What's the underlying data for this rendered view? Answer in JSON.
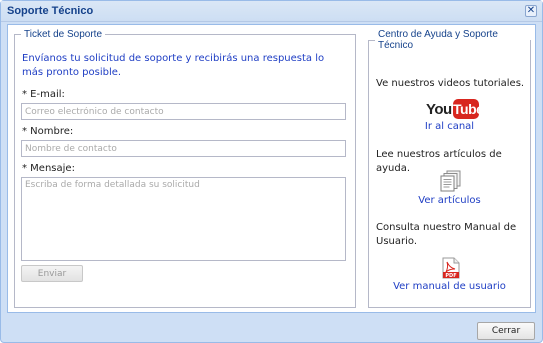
{
  "window": {
    "title": "Soporte Técnico",
    "close_glyph": "✕"
  },
  "ticket": {
    "legend": "Ticket de Soporte",
    "intro": "Envíanos tu solicitud de soporte y recibirás una respuesta lo más pronto posible.",
    "email_label": "* E-mail:",
    "email_placeholder": "Correo electrónico de contacto",
    "email_value": "",
    "name_label": "* Nombre:",
    "name_placeholder": "Nombre de contacto",
    "name_value": "",
    "message_label": "* Mensaje:",
    "message_placeholder": "Escriba de forma detallada su solicitud",
    "message_value": "",
    "send_label": "Enviar"
  },
  "help": {
    "legend": "Centro de Ayuda y Soporte Técnico",
    "videos_text": "Ve nuestros videos tutoriales.",
    "youtube_logo": {
      "you": "You",
      "tube": "Tube"
    },
    "channel_link": "Ir al canal",
    "articles_text": "Lee nuestros artículos de ayuda.",
    "articles_link": "Ver artículos",
    "manual_text": "Consulta nuestro Manual de Usuario.",
    "pdf_badge": "PDF",
    "manual_link": "Ver manual de usuario"
  },
  "footer": {
    "close_label": "Cerrar"
  },
  "icons": {
    "youtube": "youtube-logo-icon",
    "articles": "documents-stack-icon",
    "manual": "pdf-file-icon"
  },
  "colors": {
    "titlebar": "#cddef3",
    "title_text": "#15428b",
    "link": "#1f3ec4",
    "youtube_red": "#d8261f",
    "pdf_red": "#d8261f"
  }
}
